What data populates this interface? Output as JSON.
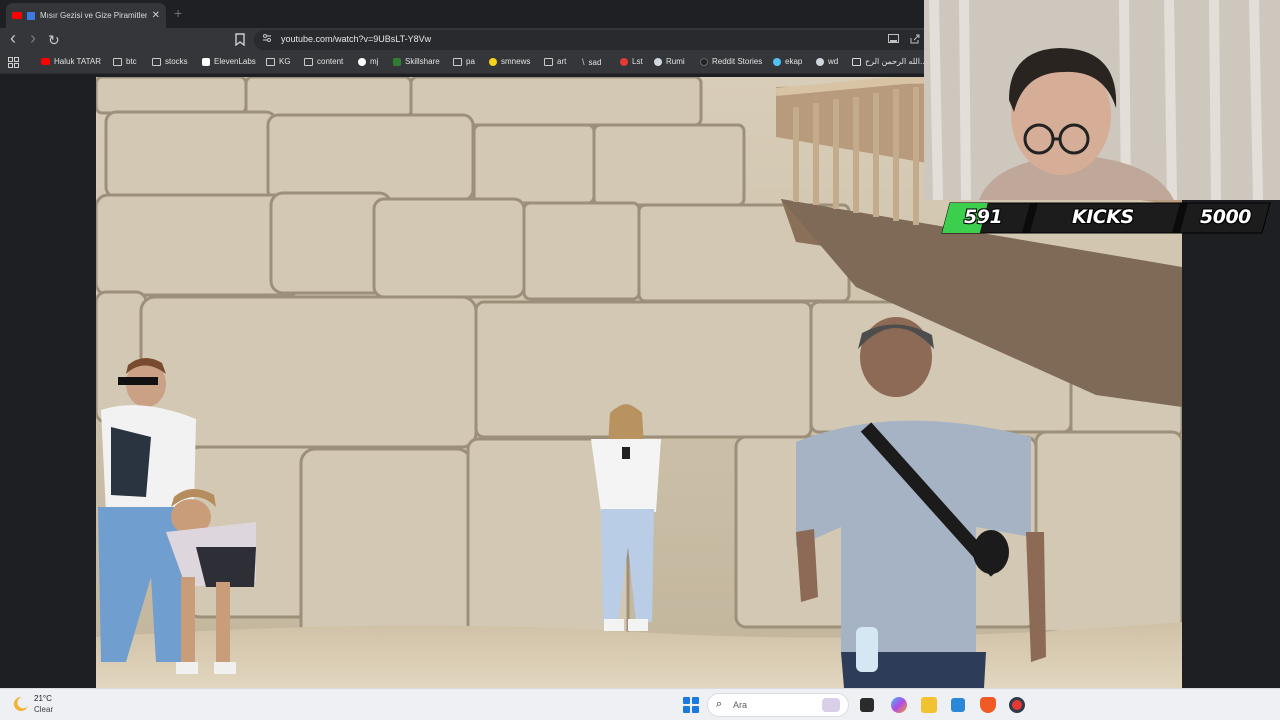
{
  "browser": {
    "tab": {
      "title": "Mısır Gezisi ve Gize Piramitleri",
      "close_glyph": "✕"
    },
    "new_tab_glyph": "+",
    "toolbar": {
      "back_glyph": "‹",
      "forward_glyph": "›",
      "reload_glyph": "↻",
      "bookmark_glyph": "☐",
      "site_info_glyph": "⚙",
      "url": "youtube.com/watch?v=9UBsLT-Y8Vw"
    },
    "bookmarks": [
      {
        "label": "Haluk TATAR",
        "icon": "youtube-icon",
        "color": "#ff0000"
      },
      {
        "label": "btc",
        "icon": "folder-icon"
      },
      {
        "label": "stocks",
        "icon": "folder-icon"
      },
      {
        "label": "ElevenLabs",
        "icon": "elevenlabs-icon",
        "color": "#ffffff"
      },
      {
        "label": "KG",
        "icon": "folder-icon"
      },
      {
        "label": "content",
        "icon": "folder-icon"
      },
      {
        "label": "mj",
        "icon": "github-icon",
        "color": "#ffffff"
      },
      {
        "label": "Skillshare",
        "icon": "skillshare-icon",
        "color": "#2e7d32"
      },
      {
        "label": "pa",
        "icon": "folder-icon"
      },
      {
        "label": "smnews",
        "icon": "smiley-icon",
        "color": "#f5d31a"
      },
      {
        "label": "art",
        "icon": "folder-icon"
      },
      {
        "label": "sad",
        "icon": "slash-icon",
        "color": "#111111"
      },
      {
        "label": "Lst",
        "icon": "s-icon",
        "color": "#e53935"
      },
      {
        "label": "Rumi",
        "icon": "globe-icon",
        "color": "#cfd8dc"
      },
      {
        "label": "Reddit Stories",
        "icon": "d-icon",
        "color": "#222222"
      },
      {
        "label": "ekap",
        "icon": "bird-icon",
        "color": "#4fc3f7"
      },
      {
        "label": "wd",
        "icon": "shield-icon",
        "color": "#cfd8dc"
      },
      {
        "label": "الله الرحمن الرح...",
        "icon": "page-icon",
        "color": "#cfd8dc"
      }
    ]
  },
  "overlay": {
    "count": "591",
    "label": "KICKS",
    "goal": "5000",
    "progress_fraction": 0.118
  },
  "taskbar": {
    "temperature": "21°C",
    "condition": "Clear",
    "search_placeholder": "Ara",
    "search_glyph": "⌕"
  },
  "colors": {
    "tab_active": "#35363a",
    "browser_bg": "#1f2023",
    "kicks_green": "#3ccf4e",
    "windows_blue": "#1a79e0"
  }
}
